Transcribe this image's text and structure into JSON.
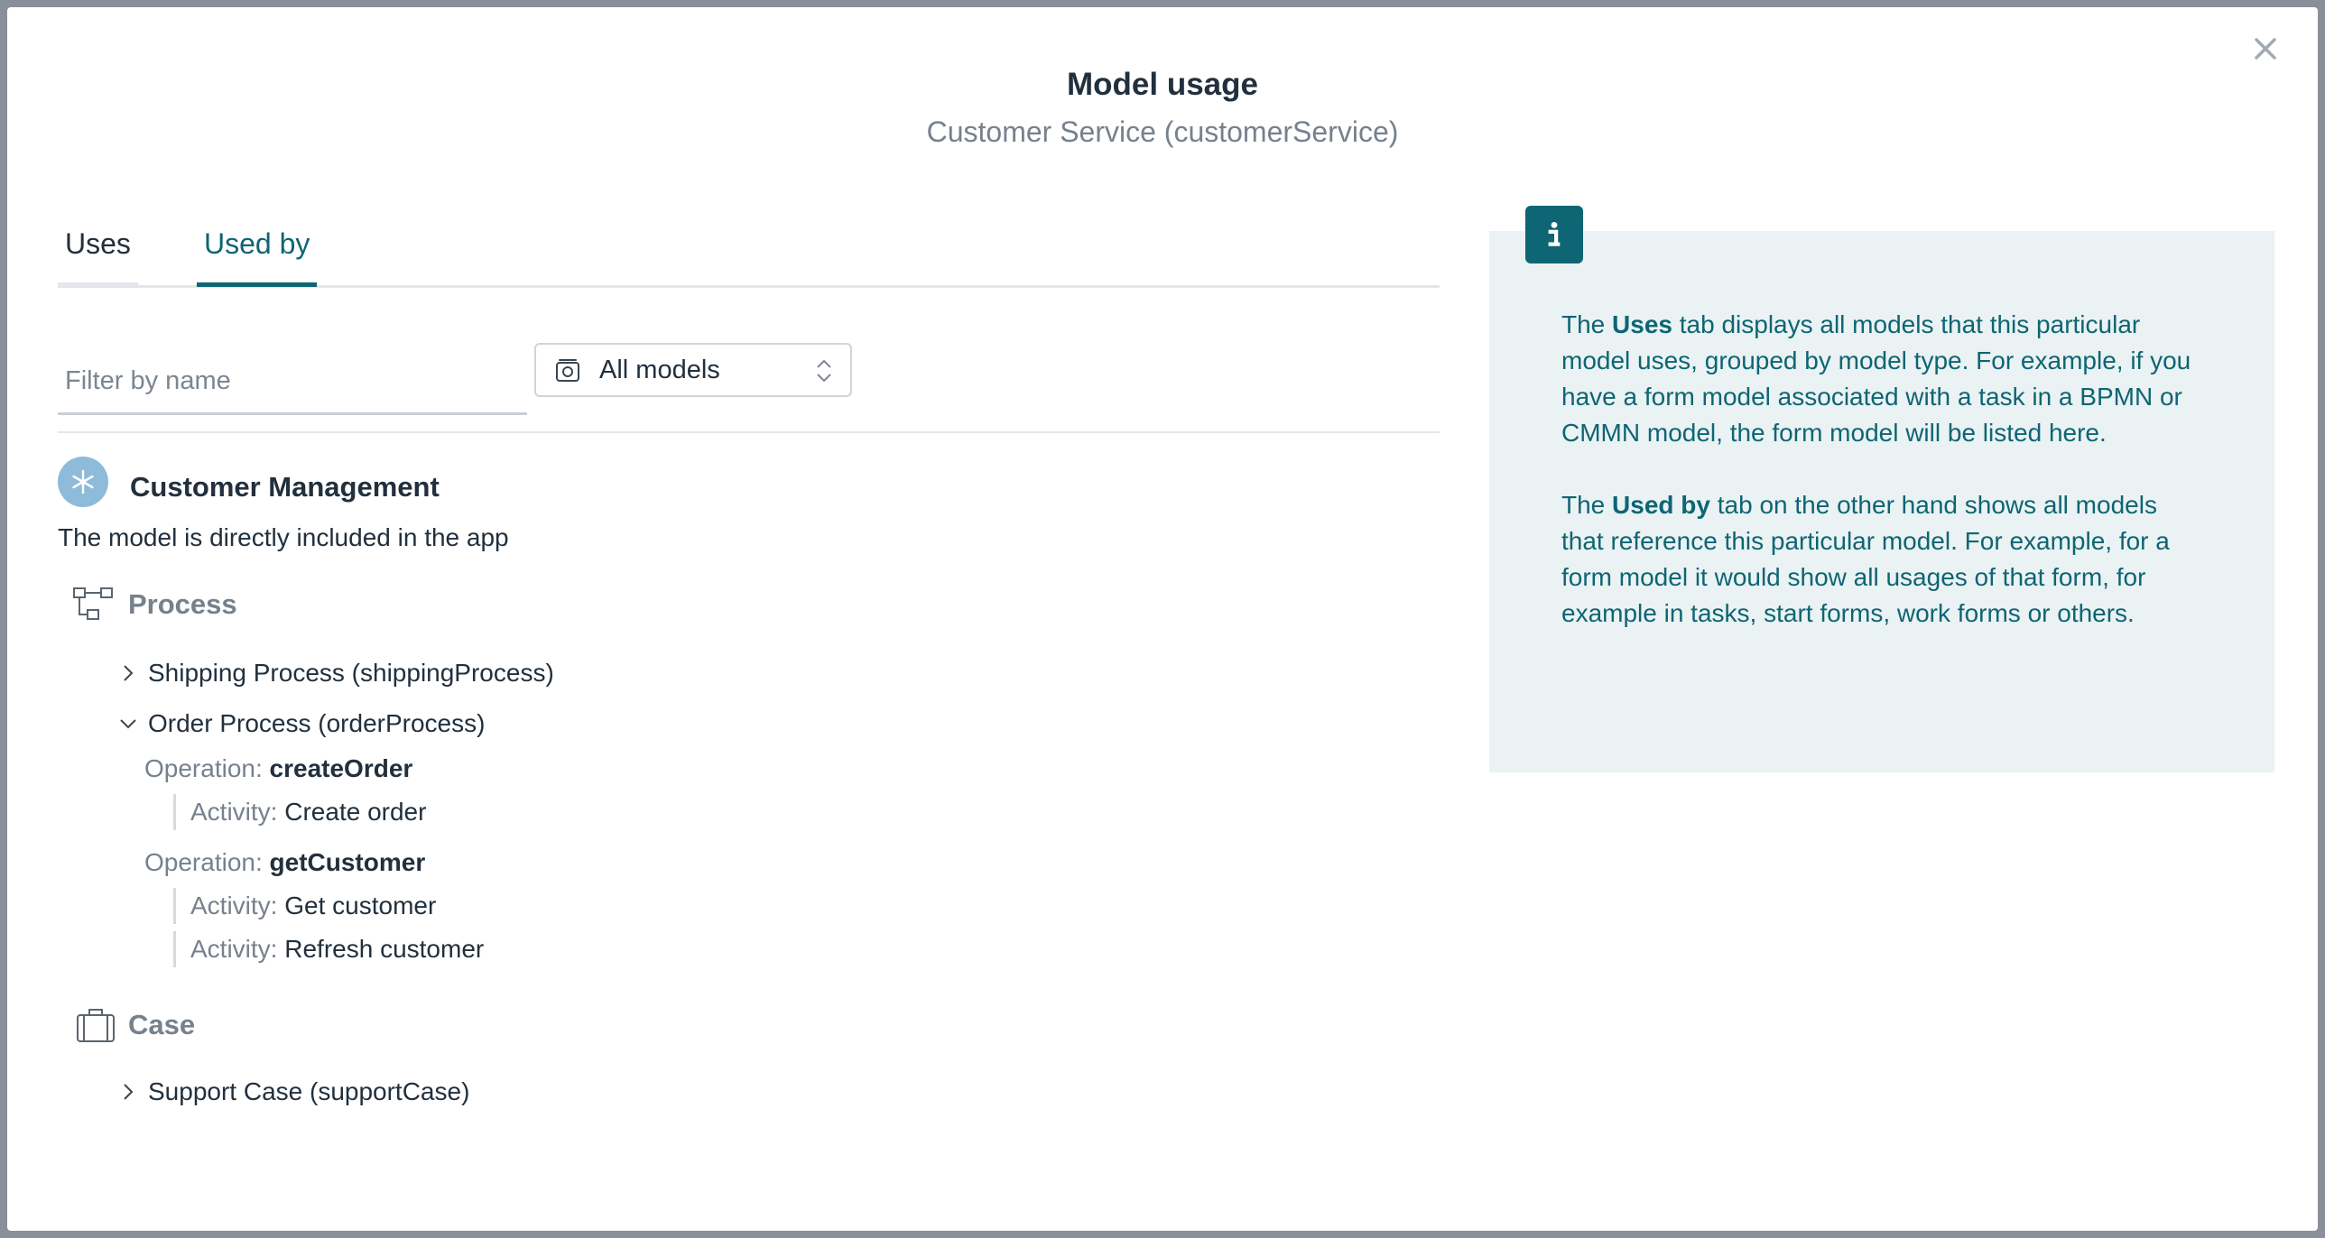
{
  "modal": {
    "title": "Model usage",
    "subtitle": "Customer Service (customerService)",
    "close_icon": "close-icon"
  },
  "tabs": [
    {
      "label": "Uses",
      "active": false
    },
    {
      "label": "Used by",
      "active": true
    }
  ],
  "filter": {
    "placeholder": "Filter by name",
    "value": ""
  },
  "model_select": {
    "selected": "All models",
    "icon": "model-stack-icon"
  },
  "app": {
    "name": "Customer Management",
    "description": "The model is directly included in the app",
    "icon": "asterisk-icon"
  },
  "sections": {
    "process": {
      "label": "Process",
      "icon": "process-icon",
      "items": [
        {
          "label": "Shipping Process (shippingProcess)",
          "expanded": false
        },
        {
          "label": "Order Process (orderProcess)",
          "expanded": true
        }
      ],
      "operations": [
        {
          "prefix": "Operation:",
          "name": "createOrder",
          "activities": [
            {
              "prefix": "Activity:",
              "name": "Create order"
            }
          ]
        },
        {
          "prefix": "Operation:",
          "name": "getCustomer",
          "activities": [
            {
              "prefix": "Activity:",
              "name": "Get customer"
            },
            {
              "prefix": "Activity:",
              "name": "Refresh customer"
            }
          ]
        }
      ]
    },
    "case": {
      "label": "Case",
      "icon": "briefcase-icon",
      "items": [
        {
          "label": "Support Case (supportCase)",
          "expanded": false
        }
      ]
    }
  },
  "info": {
    "icon": "info-icon",
    "p1": {
      "before": "The ",
      "bold": "Uses",
      "after": " tab displays all models that this particular model uses, grouped by model type. For example, if you have a form model associated with a task in a BPMN or CMMN model, the form model will be listed here."
    },
    "p2": {
      "before": "The ",
      "bold": "Used by",
      "after": " tab on the other hand shows all models that reference this particular model. For example, for a form model it would show all usages of that form, for example in tasks, start forms, work forms or others."
    }
  },
  "colors": {
    "accent": "#0e6573",
    "info_bg": "#eaf2f3",
    "app_icon_bg": "#8dbbd9",
    "text": "#22303d",
    "muted": "#77818d"
  }
}
